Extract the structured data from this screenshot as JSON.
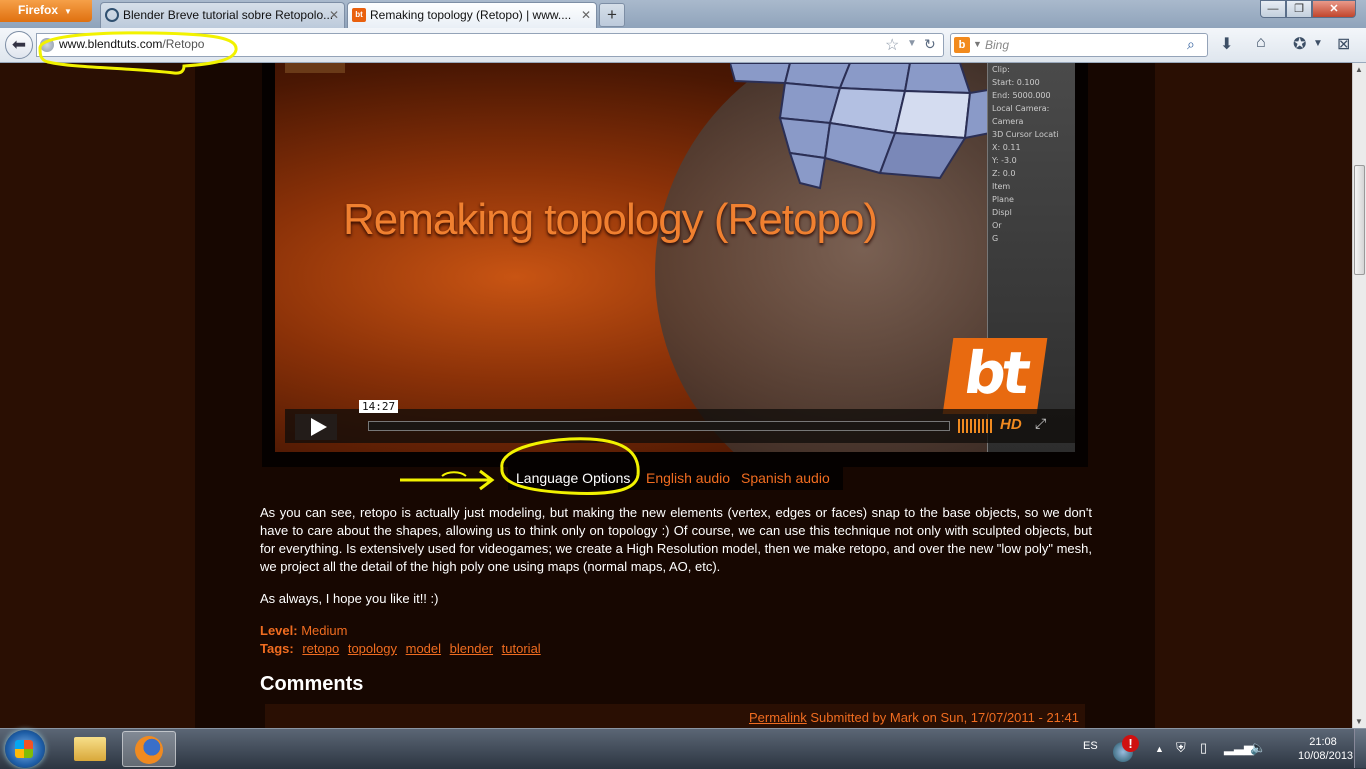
{
  "browser": {
    "app_button": "Firefox",
    "tabs": [
      {
        "title": "Blender Breve tutorial sobre Retopolo...",
        "active": false
      },
      {
        "title": "Remaking topology (Retopo) | www....",
        "active": true
      }
    ],
    "url_domain": "www.blendtuts.com",
    "url_path": "/Retopo",
    "search_engine": "Bing",
    "search_placeholder": "Bing"
  },
  "video": {
    "title": "Remaking topology (Retopo)",
    "timestamp": "14:27",
    "hd_label": "HD",
    "logo_text": "bt",
    "panel_lines": [
      "Clip:",
      "Start: 0.100",
      "End: 5000.000",
      "Local Camera:",
      "Camera",
      "3D Cursor Locati",
      "X: 0.11",
      "Y: -3.0",
      "Z: 0.0",
      "Item",
      "Plane",
      "Displ",
      "Or",
      "G"
    ]
  },
  "language": {
    "label": "Language Options",
    "links": [
      "English audio",
      "Spanish audio"
    ]
  },
  "article": {
    "paragraph1": "As you can see, retopo is actually just modeling, but making the new elements (vertex, edges or faces) snap to the base objects, so we don't have to care about the shapes, allowing us to think only on topology :) Of course, we can use this technique not only with sculpted objects, but for everything. Is extensively used for videogames; we create a High Resolution model, then we make retopo, and over the new \"low poly\" mesh, we project all the detail of the high poly one using maps (normal maps, AO, etc).",
    "paragraph2": "As always, I hope you like it!! :)",
    "level_label": "Level:",
    "level_value": "Medium",
    "tags_label": "Tags:",
    "tags": [
      "retopo",
      "topology",
      "model",
      "blender",
      "tutorial"
    ]
  },
  "comments": {
    "heading": "Comments",
    "first": {
      "permalink": "Permalink",
      "submitted": "Submitted by Mark on Sun, 17/07/2011 - 21:41"
    }
  },
  "taskbar": {
    "language": "ES",
    "time": "21:08",
    "date": "10/08/2013"
  },
  "colors": {
    "page_bg": "#2a0f03",
    "content_bg": "#170701",
    "accent": "#f06c20",
    "annotation": "#f2f200"
  }
}
